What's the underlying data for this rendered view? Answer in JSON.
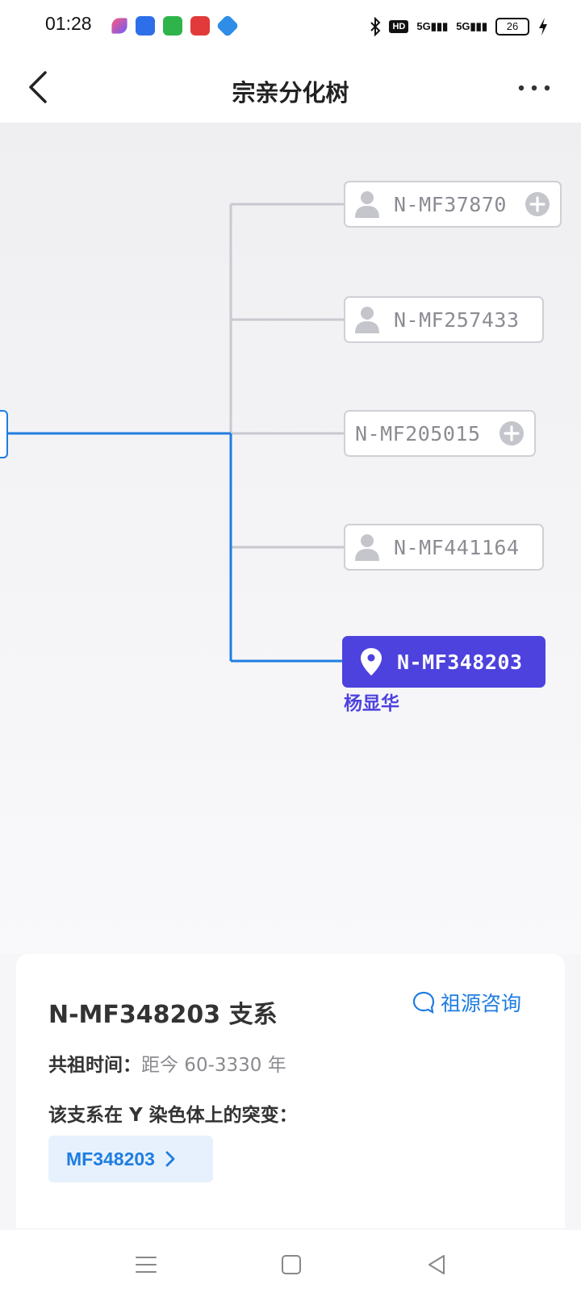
{
  "status_bar": {
    "time": "01:28",
    "hd_label": "HD",
    "signal_1": "5G",
    "signal_2": "5G",
    "battery": "26",
    "app_icons": [
      "feather-app-icon",
      "baidu-app-icon",
      "message-app-icon",
      "red-app-icon",
      "blue-app-icon"
    ]
  },
  "nav": {
    "title": "宗亲分化树"
  },
  "tree": {
    "nodes": [
      {
        "label": "N-MF37870",
        "has_person": true,
        "has_plus": true
      },
      {
        "label": "N-MF257433",
        "has_person": true,
        "has_plus": false
      },
      {
        "label": "N-MF205015",
        "has_person": false,
        "has_plus": true
      },
      {
        "label": "N-MF441164",
        "has_person": true,
        "has_plus": false
      }
    ],
    "active_node": {
      "label": "N-MF348203",
      "owner": "杨显华"
    },
    "colors": {
      "active": "#4d42de",
      "path": "#1f7de0",
      "branch": "#c8c9cf"
    }
  },
  "card": {
    "title": "N-MF348203 支系",
    "consult_label": "祖源咨询",
    "ancestor_label": "共祖时间：",
    "ancestor_value": "距今 60-3330 年",
    "mutation_label": "该支系在 Y 染色体上的突变：",
    "mutation_chip": "MF348203"
  }
}
